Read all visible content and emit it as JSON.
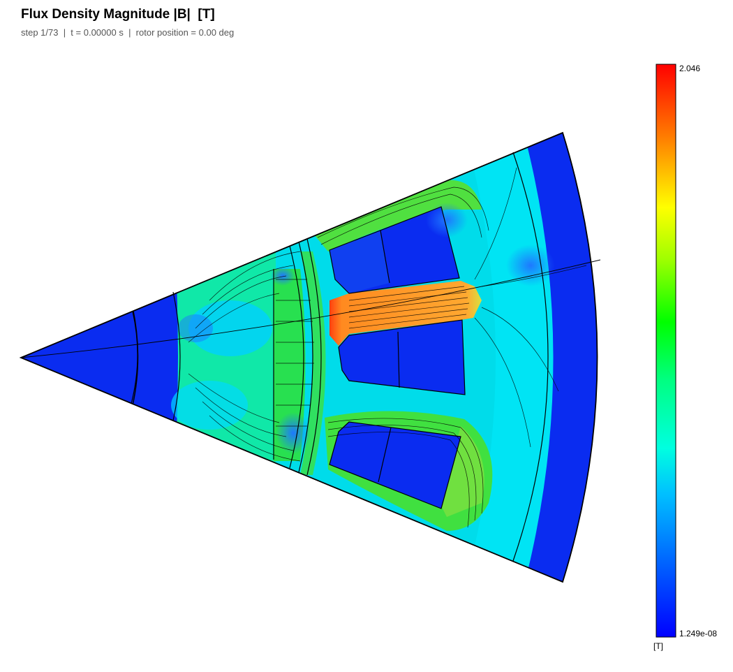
{
  "title": "Flux Density Magnitude |B|  [T]",
  "subtitle": "step 1/73  |  t = 0.00000 s  |  rotor position = 0.00 deg",
  "colorbar": {
    "max_label": "2.046",
    "min_label": "1.249e-08",
    "unit_label": "[T]",
    "max_value": 2.046,
    "min_value": 1.249e-08,
    "colormap": "jet",
    "stops": [
      "#0000ff",
      "#0080ff",
      "#00ffff",
      "#00ff80",
      "#00ff00",
      "#80ff00",
      "#ffff00",
      "#ff8000",
      "#ff0000"
    ]
  },
  "colors": {
    "low": "#0a2cf0",
    "cyan": "#00d8ff",
    "teal": "#00e8c8",
    "green": "#18e030",
    "yellowgreen": "#8ce030",
    "orange": "#ffa030",
    "red": "#ff3010"
  }
}
